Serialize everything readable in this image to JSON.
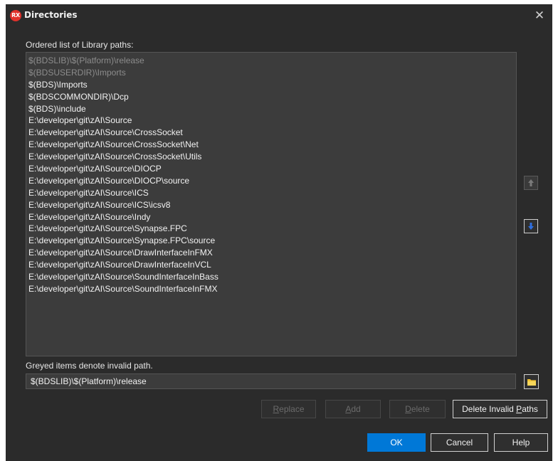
{
  "window": {
    "title": "Directories",
    "app_badge": "RX",
    "close_glyph": "✕"
  },
  "labels": {
    "list_heading": "Ordered list of Library paths:",
    "note": "Greyed items denote invalid path."
  },
  "paths": [
    {
      "text": "$(BDSLIB)\\$(Platform)\\release",
      "invalid": true
    },
    {
      "text": "$(BDSUSERDIR)\\Imports",
      "invalid": true
    },
    {
      "text": "$(BDS)\\Imports",
      "invalid": false
    },
    {
      "text": "$(BDSCOMMONDIR)\\Dcp",
      "invalid": false
    },
    {
      "text": "$(BDS)\\include",
      "invalid": false
    },
    {
      "text": "E:\\developer\\git\\zAI\\Source",
      "invalid": false
    },
    {
      "text": "E:\\developer\\git\\zAI\\Source\\CrossSocket",
      "invalid": false
    },
    {
      "text": "E:\\developer\\git\\zAI\\Source\\CrossSocket\\Net",
      "invalid": false
    },
    {
      "text": "E:\\developer\\git\\zAI\\Source\\CrossSocket\\Utils",
      "invalid": false
    },
    {
      "text": "E:\\developer\\git\\zAI\\Source\\DIOCP",
      "invalid": false
    },
    {
      "text": "E:\\developer\\git\\zAI\\Source\\DIOCP\\source",
      "invalid": false
    },
    {
      "text": "E:\\developer\\git\\zAI\\Source\\ICS",
      "invalid": false
    },
    {
      "text": "E:\\developer\\git\\zAI\\Source\\ICS\\icsv8",
      "invalid": false
    },
    {
      "text": "E:\\developer\\git\\zAI\\Source\\Indy",
      "invalid": false
    },
    {
      "text": "E:\\developer\\git\\zAI\\Source\\Synapse.FPC",
      "invalid": false
    },
    {
      "text": "E:\\developer\\git\\zAI\\Source\\Synapse.FPC\\source",
      "invalid": false
    },
    {
      "text": "E:\\developer\\git\\zAI\\Source\\DrawInterfaceInFMX",
      "invalid": false
    },
    {
      "text": "E:\\developer\\git\\zAI\\Source\\DrawInterfaceInVCL",
      "invalid": false
    },
    {
      "text": "E:\\developer\\git\\zAI\\Source\\SoundInterfaceInBass",
      "invalid": false
    },
    {
      "text": "E:\\developer\\git\\zAI\\Source\\SoundInterfaceInFMX",
      "invalid": false
    }
  ],
  "path_input": {
    "value": "$(BDSLIB)\\$(Platform)\\release"
  },
  "icons": {
    "move_up": "arrow-up-icon",
    "move_down": "arrow-down-icon",
    "browse": "folder-icon",
    "close": "close-icon"
  },
  "buttons": {
    "replace": {
      "label": "Replace",
      "enabled": false
    },
    "add": {
      "label": "Add",
      "enabled": false
    },
    "delete": {
      "label": "Delete",
      "enabled": false
    },
    "delete_invalid": {
      "label": "Delete Invalid Paths",
      "enabled": true
    },
    "ok": {
      "label": "OK"
    },
    "cancel": {
      "label": "Cancel"
    },
    "help": {
      "label": "Help"
    }
  },
  "colors": {
    "background": "#2b2b2b",
    "list_bg": "#3c3c3c",
    "invalid_text": "#8c8c8c",
    "accent": "#0078d7",
    "arrow_blue": "#2f6fe0",
    "folder": "#f2c232"
  }
}
